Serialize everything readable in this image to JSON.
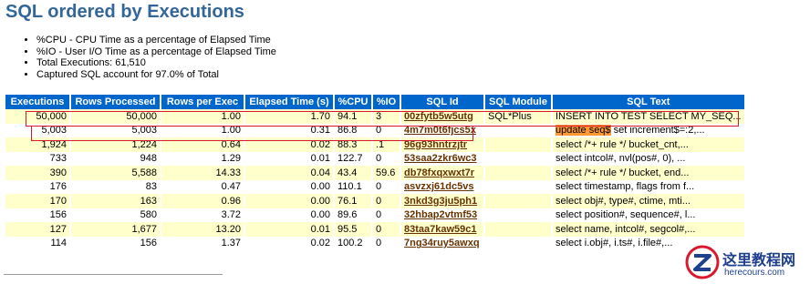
{
  "page": {
    "title": "SQL ordered by Executions",
    "bullets": [
      "%CPU - CPU Time as a percentage of Elapsed Time",
      "%IO - User I/O Time as a percentage of Elapsed Time",
      "Total Executions: 61,510",
      "Captured SQL account for 97.0% of Total"
    ]
  },
  "table": {
    "headers": [
      "Executions",
      "Rows Processed",
      "Rows per Exec",
      "Elapsed Time (s)",
      "%CPU",
      "%IO",
      "SQL Id",
      "SQL Module",
      "SQL Text"
    ],
    "rows": [
      {
        "executions": "50,000",
        "rows_processed": "50,000",
        "rows_per_exec": "1.00",
        "elapsed": "1.70",
        "cpu": "94.1",
        "io": "3",
        "sql_id": "00zfytb5w5utg",
        "module": "SQL*Plus",
        "text_hl": "",
        "text": "INSERT INTO TEST SELECT MY_SEQ..."
      },
      {
        "executions": "5,003",
        "rows_processed": "5,003",
        "rows_per_exec": "1.00",
        "elapsed": "0.31",
        "cpu": "86.8",
        "io": "0",
        "sql_id": "4m7m0t6fjcs5x",
        "module": "",
        "text_hl": "update seq$",
        "text": " set increment$=:2,..."
      },
      {
        "executions": "1,924",
        "rows_processed": "1,224",
        "rows_per_exec": "0.64",
        "elapsed": "0.02",
        "cpu": "88.3",
        "io": ".1",
        "sql_id": "96g93hntrzjtr",
        "module": "",
        "text_hl": "",
        "text": "select /*+ rule */ bucket_cnt,..."
      },
      {
        "executions": "733",
        "rows_processed": "948",
        "rows_per_exec": "1.29",
        "elapsed": "0.01",
        "cpu": "122.7",
        "io": "0",
        "sql_id": "53saa2zkr6wc3",
        "module": "",
        "text_hl": "",
        "text": "select intcol#, nvl(pos#, 0), ..."
      },
      {
        "executions": "390",
        "rows_processed": "5,588",
        "rows_per_exec": "14.33",
        "elapsed": "0.04",
        "cpu": "43.4",
        "io": "59.6",
        "sql_id": "db78fxqxwxt7r",
        "module": "",
        "text_hl": "",
        "text": "select /*+ rule */ bucket, end..."
      },
      {
        "executions": "176",
        "rows_processed": "83",
        "rows_per_exec": "0.47",
        "elapsed": "0.00",
        "cpu": "110.1",
        "io": "0",
        "sql_id": "asvzxj61dc5vs",
        "module": "",
        "text_hl": "",
        "text": "select timestamp, flags from f..."
      },
      {
        "executions": "170",
        "rows_processed": "163",
        "rows_per_exec": "0.96",
        "elapsed": "0.00",
        "cpu": "76.1",
        "io": "0",
        "sql_id": "3nkd3g3ju5ph1",
        "module": "",
        "text_hl": "",
        "text": "select obj#, type#, ctime, mti..."
      },
      {
        "executions": "156",
        "rows_processed": "580",
        "rows_per_exec": "3.72",
        "elapsed": "0.00",
        "cpu": "89.6",
        "io": "0",
        "sql_id": "32hbap2vtmf53",
        "module": "",
        "text_hl": "",
        "text": "select position#, sequence#, l..."
      },
      {
        "executions": "127",
        "rows_processed": "1,677",
        "rows_per_exec": "13.20",
        "elapsed": "0.01",
        "cpu": "95.5",
        "io": "0",
        "sql_id": "83taa7kaw59c1",
        "module": "",
        "text_hl": "",
        "text": "select name, intcol#, segcol#,..."
      },
      {
        "executions": "114",
        "rows_processed": "156",
        "rows_per_exec": "1.37",
        "elapsed": "0.02",
        "cpu": "100.2",
        "io": "0",
        "sql_id": "7ng34ruy5awxq",
        "module": "",
        "text_hl": "",
        "text": "select i.obj#, i.ts#, i.file#,..."
      }
    ]
  },
  "watermark": {
    "cn": "这里教程网",
    "url": "herecours.com"
  },
  "colors": {
    "title": "#336699",
    "header_bg": "#0066cc",
    "row_alt_bg": "#ffffcc",
    "sql_id_link": "#663300",
    "highlight": "#ff9933",
    "annotation_box": "#d9192d"
  }
}
